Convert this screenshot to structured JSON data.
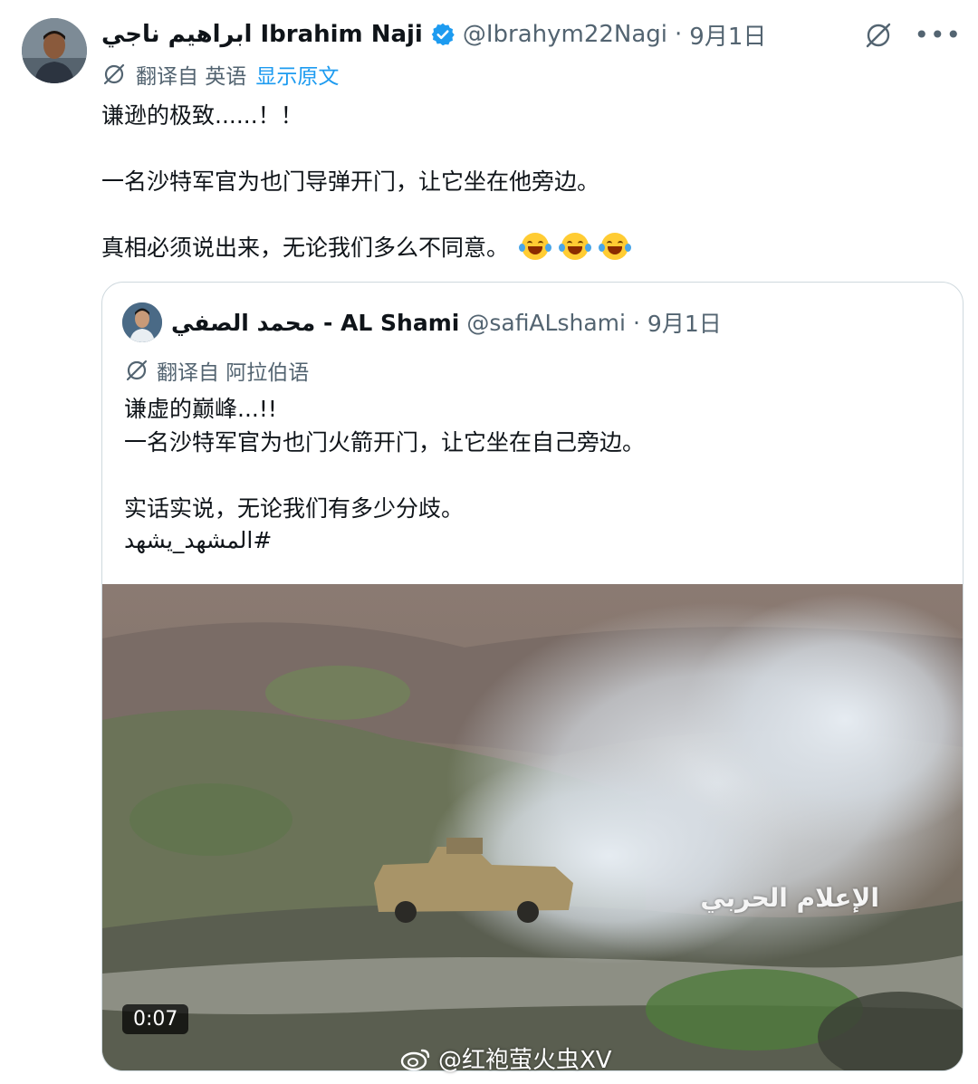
{
  "tweet": {
    "author_name": "ابراهيم ناجي Ibrahim Naji",
    "handle": "@Ibrahym22Nagi",
    "separator": "·",
    "date": "9月1日",
    "translated_from": "翻译自 英语",
    "show_original": "显示原文",
    "lines": [
      "谦逊的极致......！！",
      "一名沙特军官为也门导弹开门，让它坐在他旁边。",
      "真相必须说出来，无论我们多么不同意。"
    ],
    "emoji_icon": "face-with-tears-of-joy-icon"
  },
  "quoted_tweet": {
    "author_name": "محمد الصفي - AL Shami",
    "handle": "@safiALshami",
    "separator": "·",
    "date": "9月1日",
    "translated_from": "翻译自 阿拉伯语",
    "lines": [
      "谦虚的巅峰...!!",
      "一名沙特军官为也门火箭开门，让它坐在自己旁边。",
      "实话实说，无论我们有多少分歧。",
      "#المشهد_يشهد"
    ],
    "video": {
      "duration": "0:07",
      "overlay_text": "الإعلام الحربي"
    }
  },
  "watermark": {
    "text": "@红袍萤火虫XV"
  },
  "colors": {
    "accent": "#1d9bf0",
    "secondary_text": "#536471",
    "border": "#cfd9de"
  }
}
